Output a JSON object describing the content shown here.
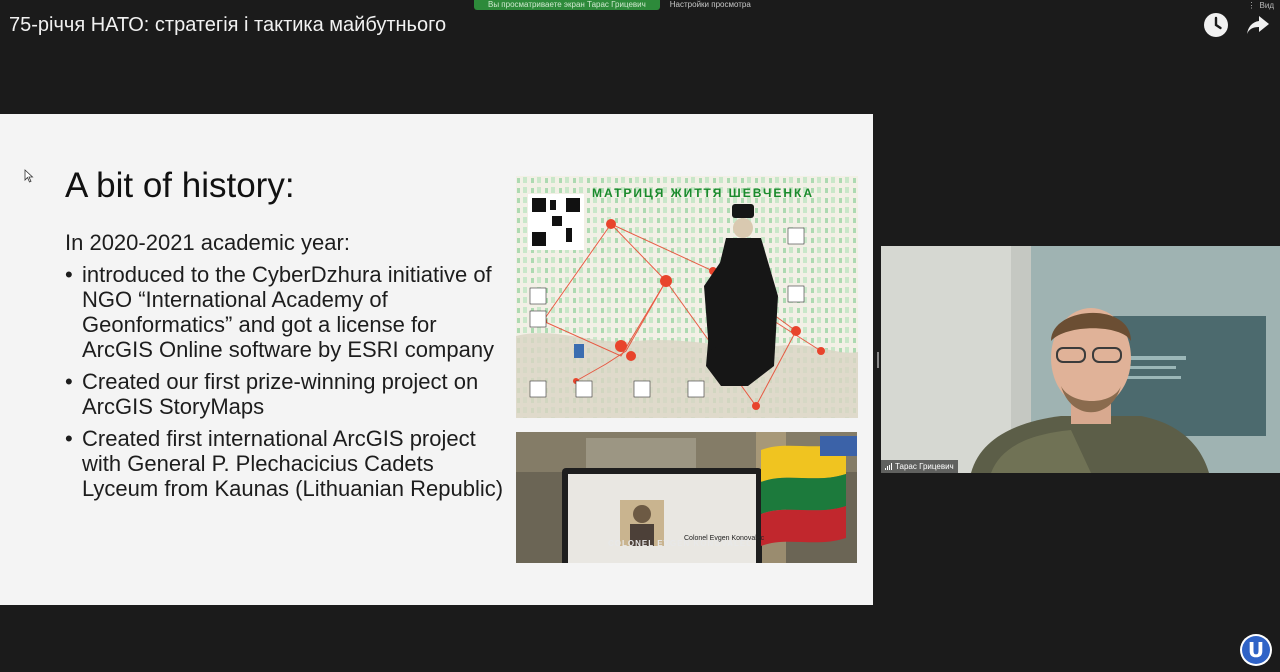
{
  "zoom_bar": {
    "viewing_label": "Вы просматриваете экран Тарас Грицевич",
    "settings_label": "Настройки просмотра",
    "corner_label": "Вид"
  },
  "video": {
    "title": "75-річчя НАТО: стратегія і тактика майбутнього",
    "watch_later_icon": "clock-icon",
    "share_icon": "share-icon"
  },
  "slide": {
    "title": "A bit of history:",
    "intro": "In 2020-2021 academic year:",
    "bullet_char": "•",
    "bullets": [
      " introduced to the CyberDzhura initiative of NGO “International Academy of Geonformatics” and got a license for ArcGIS Online  software by ESRI company",
      "Created our first prize-winning project on ArcGIS StoryMaps",
      "Created first international ArcGIS project with General P. Plechacicius Cadets Lyceum from Kaunas (Lithuanian Republic)"
    ],
    "poster_title": "МАТРИЦЯ ЖИТТЯ ШЕВЧЕНКА",
    "photo_caption": "COLONEL EVGEN KONOVALEC",
    "photo_caption_overlay": "Colonel Evgen Konovalec"
  },
  "participant": {
    "name": "Тарас Грицевич"
  },
  "colors": {
    "background": "#1b1b1b",
    "zoom_green": "#2d8a3a",
    "accent_red": "#e8442c",
    "poster_green": "#1a8a2c",
    "logo_blue": "#2f63c7"
  },
  "logo": {
    "letter": "U",
    "icon": "channel-logo-icon"
  }
}
